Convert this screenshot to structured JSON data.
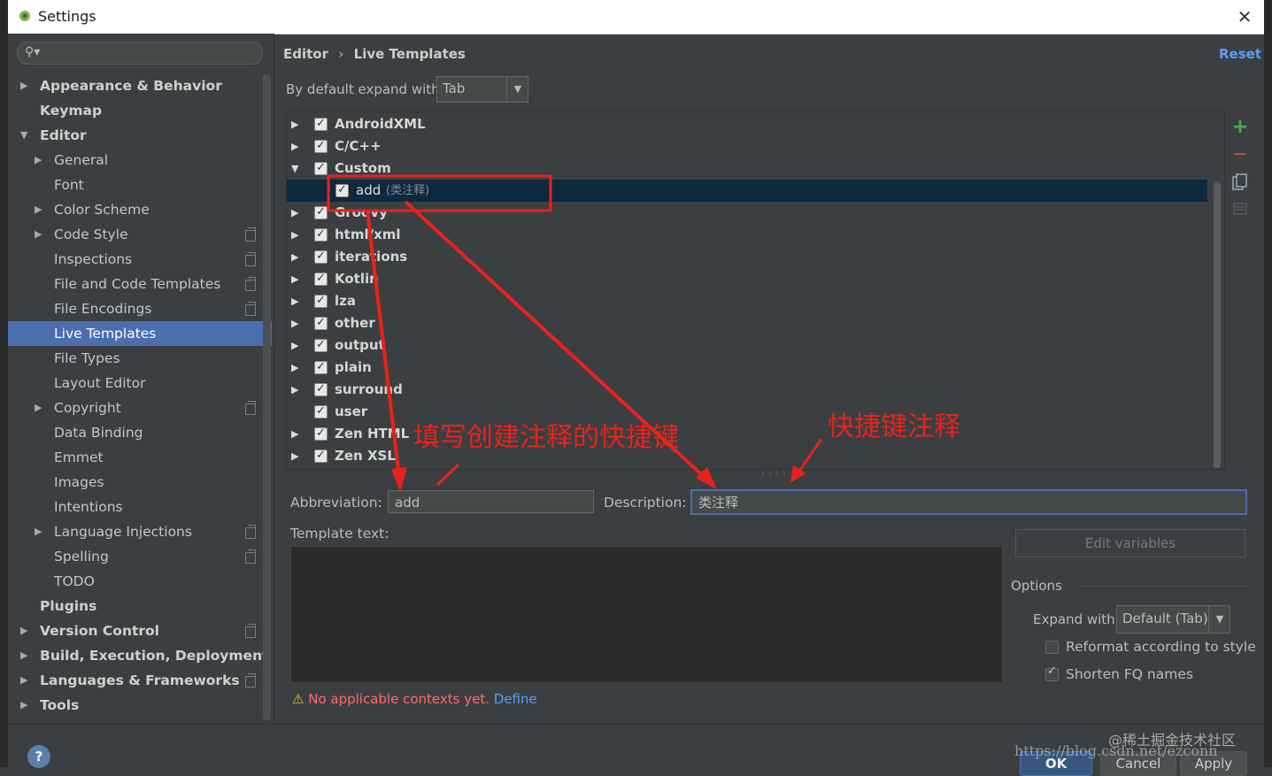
{
  "window": {
    "title": "Settings",
    "close": "✕"
  },
  "search": {
    "icon": "search-icon",
    "placeholder": ""
  },
  "sidebar": {
    "items": [
      {
        "label": "Appearance & Behavior",
        "level": 0,
        "expandable": true,
        "bold": true
      },
      {
        "label": "Keymap",
        "level": 0,
        "expandable": false,
        "bold": true
      },
      {
        "label": "Editor",
        "level": 0,
        "expandable": true,
        "expanded": true,
        "bold": true
      },
      {
        "label": "General",
        "level": 1,
        "expandable": true
      },
      {
        "label": "Font",
        "level": 1
      },
      {
        "label": "Color Scheme",
        "level": 1,
        "expandable": true
      },
      {
        "label": "Code Style",
        "level": 1,
        "expandable": true,
        "project": true
      },
      {
        "label": "Inspections",
        "level": 1,
        "project": true
      },
      {
        "label": "File and Code Templates",
        "level": 1,
        "project": true
      },
      {
        "label": "File Encodings",
        "level": 1,
        "project": true
      },
      {
        "label": "Live Templates",
        "level": 1,
        "selected": true
      },
      {
        "label": "File Types",
        "level": 1
      },
      {
        "label": "Layout Editor",
        "level": 1
      },
      {
        "label": "Copyright",
        "level": 1,
        "expandable": true,
        "project": true
      },
      {
        "label": "Data Binding",
        "level": 1
      },
      {
        "label": "Emmet",
        "level": 1
      },
      {
        "label": "Images",
        "level": 1
      },
      {
        "label": "Intentions",
        "level": 1
      },
      {
        "label": "Language Injections",
        "level": 1,
        "expandable": true,
        "project": true
      },
      {
        "label": "Spelling",
        "level": 1,
        "project": true
      },
      {
        "label": "TODO",
        "level": 1
      },
      {
        "label": "Plugins",
        "level": 0,
        "bold": true
      },
      {
        "label": "Version Control",
        "level": 0,
        "expandable": true,
        "bold": true,
        "project": true
      },
      {
        "label": "Build, Execution, Deployment",
        "level": 0,
        "expandable": true,
        "bold": true
      },
      {
        "label": "Languages & Frameworks",
        "level": 0,
        "expandable": true,
        "bold": true,
        "project": true
      },
      {
        "label": "Tools",
        "level": 0,
        "expandable": true,
        "bold": true
      }
    ]
  },
  "main": {
    "breadcrumb": {
      "parent": "Editor",
      "separator": "›",
      "current": "Live Templates"
    },
    "reset": "Reset",
    "expand_label": "By default expand with",
    "expand_value": "Tab",
    "templates": [
      {
        "name": "AndroidXML",
        "group": true,
        "checked": true
      },
      {
        "name": "C/C++",
        "group": true,
        "checked": true
      },
      {
        "name": "Custom",
        "group": true,
        "checked": true,
        "expanded": true
      },
      {
        "name": "add",
        "desc": "(类注释)",
        "group": false,
        "checked": true,
        "selected": true
      },
      {
        "name": "Groovy",
        "group": true,
        "checked": true
      },
      {
        "name": "html/xml",
        "group": true,
        "checked": true
      },
      {
        "name": "iterations",
        "group": true,
        "checked": true
      },
      {
        "name": "Kotlin",
        "group": true,
        "checked": true
      },
      {
        "name": "lza",
        "group": true,
        "checked": true
      },
      {
        "name": "other",
        "group": true,
        "checked": true
      },
      {
        "name": "output",
        "group": true,
        "checked": true
      },
      {
        "name": "plain",
        "group": true,
        "checked": true
      },
      {
        "name": "surround",
        "group": true,
        "checked": true
      },
      {
        "name": "user",
        "group": true,
        "checked": true,
        "no_arrow": true
      },
      {
        "name": "Zen HTML",
        "group": true,
        "checked": true
      },
      {
        "name": "Zen XSL",
        "group": true,
        "checked": true
      }
    ],
    "tools": {
      "add": "+",
      "remove": "—"
    },
    "abbreviation_label": "Abbreviation:",
    "abbreviation_value": "add",
    "description_label": "Description:",
    "description_value": "类注释",
    "template_text_label": "Template text:",
    "edit_variables": "Edit variables",
    "options": {
      "title": "Options",
      "expand_with_label": "Expand with",
      "expand_with_value": "Default (Tab)",
      "reformat": {
        "label": "Reformat according to style",
        "checked": false
      },
      "shorten": {
        "label": "Shorten FQ names",
        "checked": true
      }
    },
    "warning": {
      "text": "No applicable contexts yet.",
      "link": "Define"
    }
  },
  "buttons": {
    "ok": "OK",
    "cancel": "Cancel",
    "apply": "Apply",
    "help": "?"
  },
  "annotations": {
    "left": "填写创建注释的快捷键",
    "right": "快捷键注释",
    "color": "#e8221b"
  },
  "watermark": {
    "line1": "@稀土掘金技术社区",
    "line2": "https://blog.csdn.net/ezconn"
  }
}
